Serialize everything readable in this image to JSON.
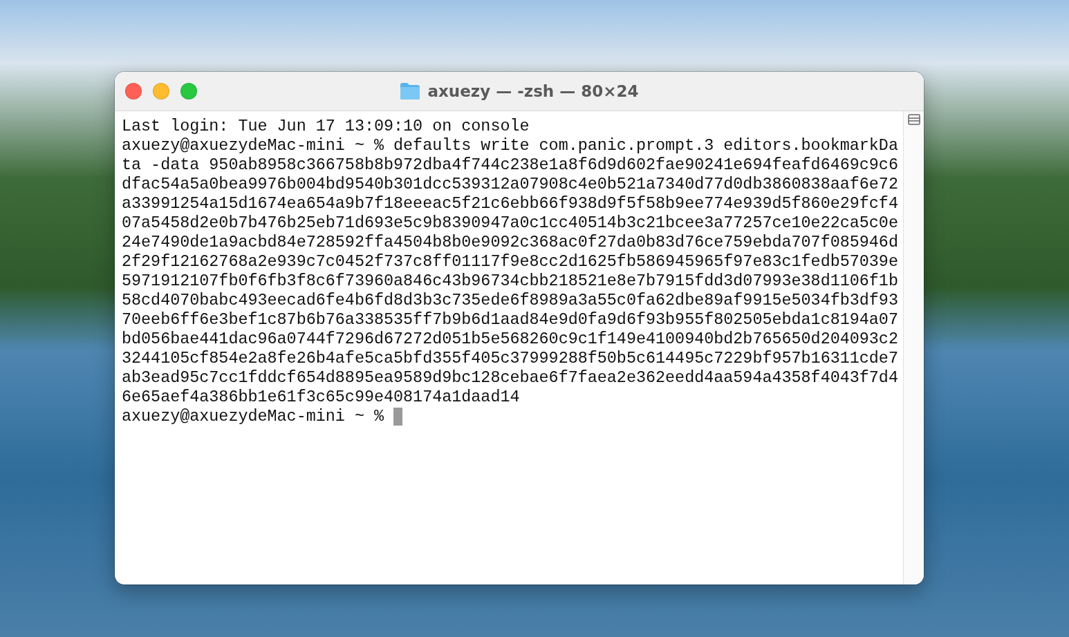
{
  "window": {
    "title": "axuezy — -zsh — 80×24"
  },
  "terminal": {
    "lines": [
      "Last login: Tue Jun 17 13:09:10 on console",
      "axuezy@axuezydeMac-mini ~ % defaults write com.panic.prompt.3 editors.bookmarkDa",
      "ta -data 950ab8958c366758b8b972dba4f744c238e1a8f6d9d602fae90241e694feafd6469c9c6",
      "dfac54a5a0bea9976b004bd9540b301dcc539312a07908c4e0b521a7340d77d0db3860838aaf6e72",
      "a33991254a15d1674ea654a9b7f18eeeac5f21c6ebb66f938d9f5f58b9ee774e939d5f860e29fcf4",
      "07a5458d2e0b7b476b25eb71d693e5c9b8390947a0c1cc40514b3c21bcee3a77257ce10e22ca5c0e",
      "24e7490de1a9acbd84e728592ffa4504b8b0e9092c368ac0f27da0b83d76ce759ebda707f085946d",
      "2f29f12162768a2e939c7c0452f737c8ff01117f9e8cc2d1625fb586945965f97e83c1fedb57039e",
      "5971912107fb0f6fb3f8c6f73960a846c43b96734cbb218521e8e7b7915fdd3d07993e38d1106f1b",
      "58cd4070babc493eecad6fe4b6fd8d3b3c735ede6f8989a3a55c0fa62dbe89af9915e5034fb3df93",
      "70eeb6ff6e3bef1c87b6b76a338535ff7b9b6d1aad84e9d0fa9d6f93b955f802505ebda1c8194a07",
      "bd056bae441dac96a0744f7296d67272d051b5e568260c9c1f149e4100940bd2b765650d204093c2",
      "3244105cf854e2a8fe26b4afe5ca5bfd355f405c37999288f50b5c614495c7229bf957b16311cde7",
      "ab3ead95c7cc1fddcf654d8895ea9589d9bc128cebae6f7faea2e362eedd4aa594a4358f4043f7d4",
      "6e65aef4a386bb1e61f3c65c99e408174a1daad14"
    ],
    "prompt": {
      "text": "axuezy@axuezydeMac-mini ~ %",
      "cursor": true
    }
  }
}
